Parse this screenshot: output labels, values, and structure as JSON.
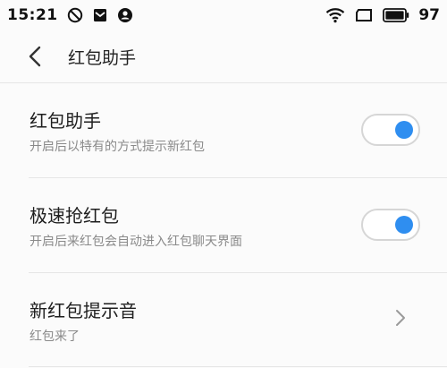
{
  "status_bar": {
    "time": "15:21",
    "left_icons": [
      "do-not-disturb-icon",
      "mail-icon",
      "account-icon"
    ],
    "right_icons": [
      "wifi-icon",
      "screen-rotate-icon",
      "battery-icon"
    ],
    "battery_level": "97"
  },
  "header": {
    "back_icon": "chevron-left-icon",
    "title": "红包助手"
  },
  "settings": [
    {
      "title": "红包助手",
      "subtitle": "开启后以特有的方式提示新红包",
      "control": "toggle",
      "on": true
    },
    {
      "title": "极速抢红包",
      "subtitle": "开启后来红包会自动进入红包聊天界面",
      "control": "toggle",
      "on": true
    },
    {
      "title": "新红包提示音",
      "subtitle": "红包来了",
      "control": "chevron-right-icon"
    }
  ],
  "colors": {
    "accent": "#2f8ef0",
    "background": "#fbfbfb",
    "divider": "#e6e6e6",
    "subtitle": "#8a8a8a"
  }
}
